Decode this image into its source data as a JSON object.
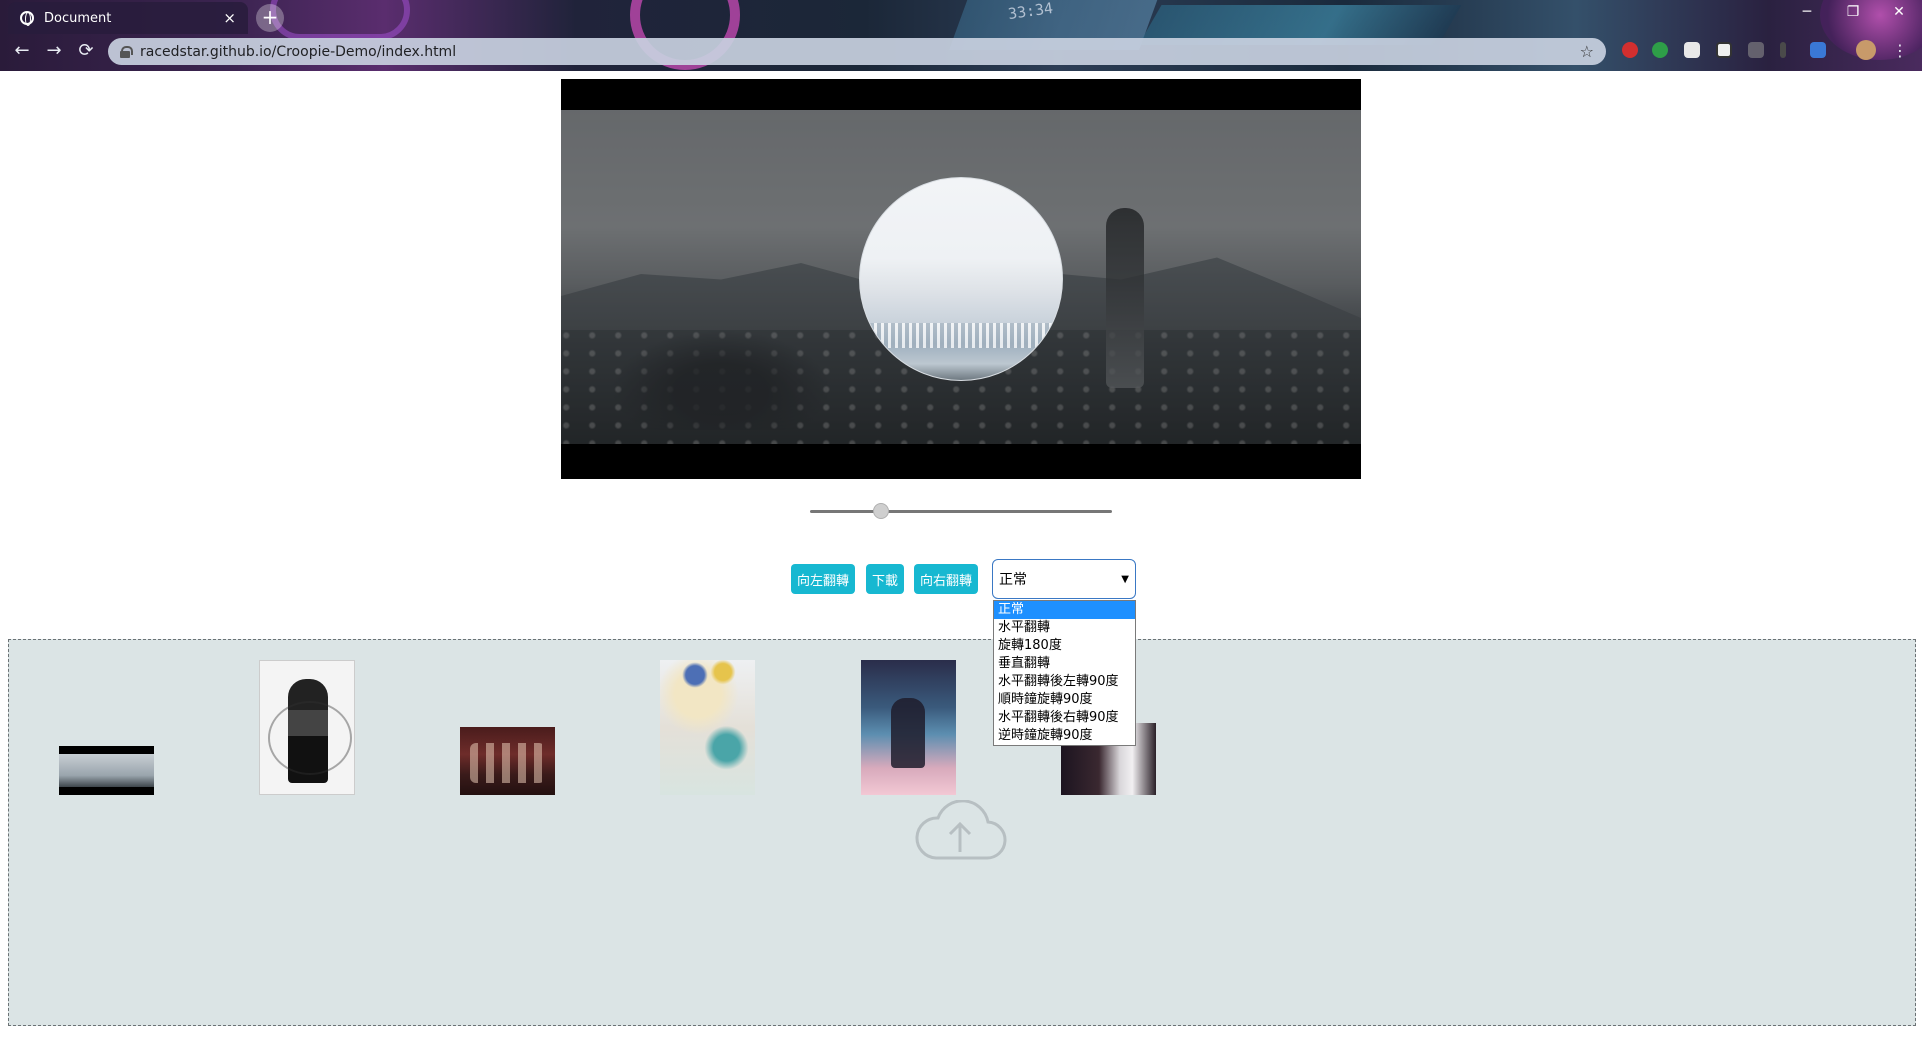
{
  "browser": {
    "tab_title": "Document",
    "tab_close": "×",
    "new_tab": "+",
    "url": "racedstar.github.io/Croopie-Demo/index.html",
    "clock": "33:34",
    "back": "←",
    "forward": "→",
    "reload": "⟳",
    "star": "☆",
    "window_controls": {
      "minimize": "─",
      "restore": "❐",
      "close": "✕"
    }
  },
  "cropper": {
    "zoom_level": 0.22
  },
  "controls": {
    "rotate_left_label": "向左翻轉",
    "download_label": "下載",
    "rotate_right_label": "向右翻轉",
    "orientation_select": {
      "selected": "正常",
      "caret": "▼",
      "options": [
        "正常",
        "水平翻轉",
        "旋轉180度",
        "垂直翻轉",
        "水平翻轉後左轉90度",
        "順時鐘旋轉90度",
        "水平翻轉後右轉90度",
        "逆時鐘旋轉90度"
      ]
    }
  },
  "dropzone": {
    "upload_icon": "cloud-upload-icon",
    "thumbnail_count": 6
  },
  "colors": {
    "button_bg": "#17b8d1",
    "dropzone_bg": "#dbe4e5",
    "selected_option": "#1e90ff"
  }
}
